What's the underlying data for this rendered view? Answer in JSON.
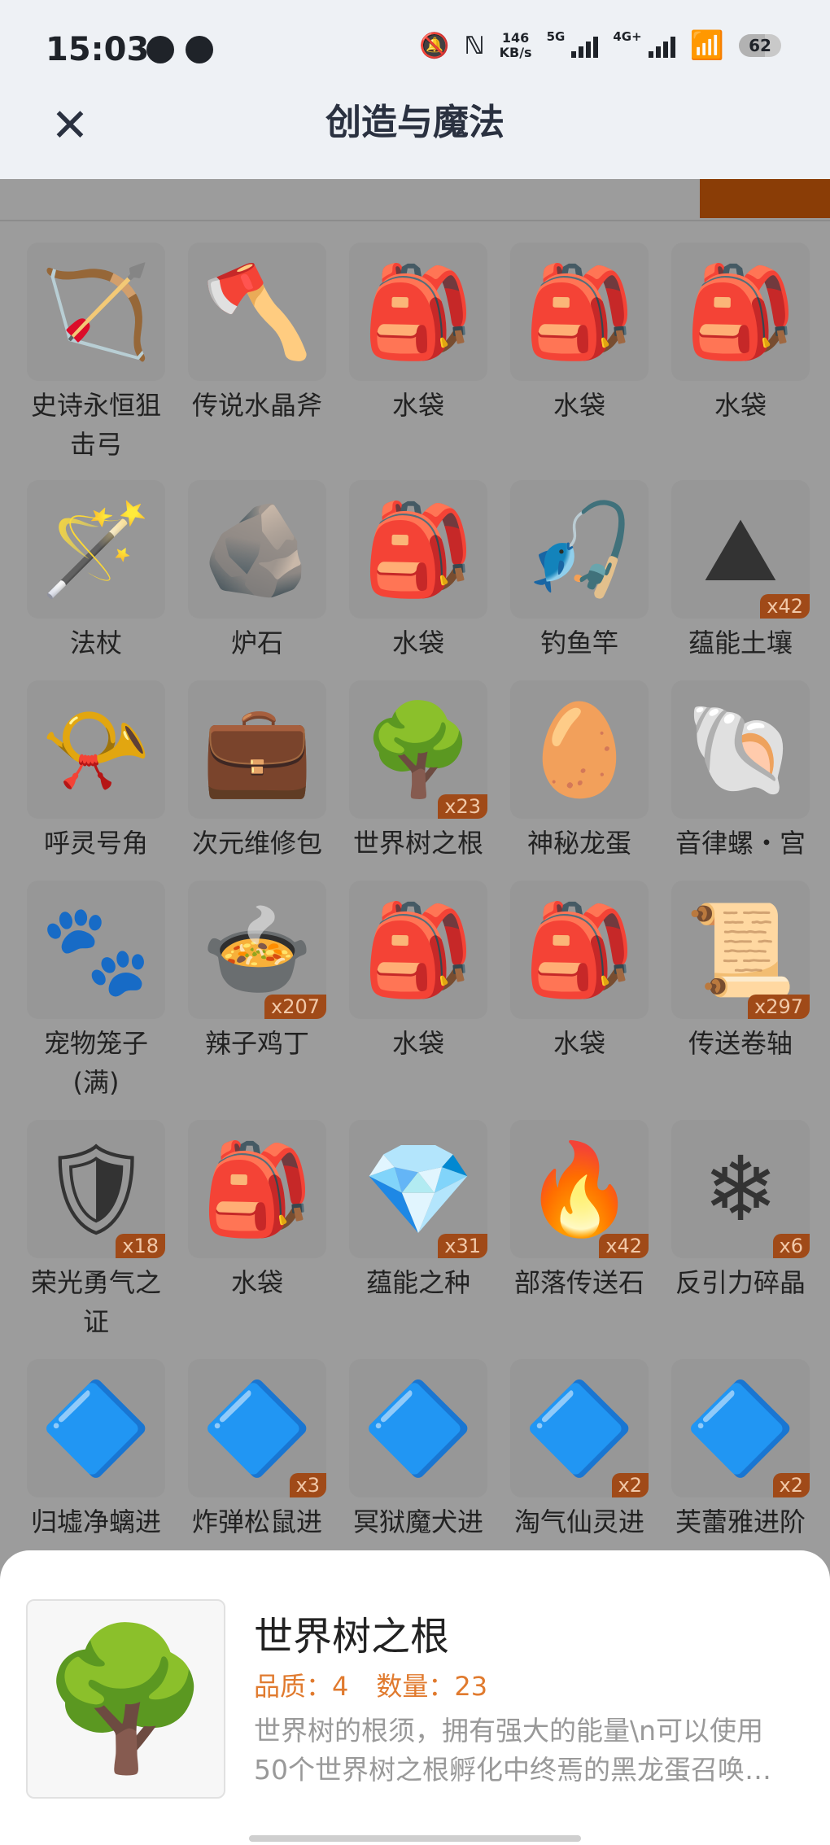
{
  "status_bar": {
    "time": "15:03",
    "left_icons": [
      "qq-icon",
      "wechat-icon"
    ],
    "speed": "146",
    "speed_unit": "KB/s",
    "network_1": "5G",
    "network_2": "4G+",
    "battery": "62"
  },
  "header": {
    "close_label": "✕",
    "title": "创造与魔法"
  },
  "colors": {
    "overlay_grey": "#9c9c9c",
    "badge": "#a04a18",
    "quality_orange": "#e07a2e",
    "active_tab": "#8a3d06"
  },
  "items": [
    [
      {
        "name": "史诗永恒狙击弓",
        "icon": "bow-icon",
        "glyph": "🏹"
      },
      {
        "name": "传说水晶斧",
        "icon": "axe-icon",
        "glyph": "🪓"
      },
      {
        "name": "水袋",
        "icon": "waterbag-icon",
        "glyph": "🎒"
      },
      {
        "name": "水袋",
        "icon": "waterbag-icon",
        "glyph": "🎒"
      },
      {
        "name": "水袋",
        "icon": "waterbag-icon",
        "glyph": "🎒"
      }
    ],
    [
      {
        "name": "法杖",
        "icon": "staff-icon",
        "glyph": "🪄"
      },
      {
        "name": "炉石",
        "icon": "hearthstone-icon",
        "glyph": "🪨"
      },
      {
        "name": "水袋",
        "icon": "waterbag-icon",
        "glyph": "🎒"
      },
      {
        "name": "钓鱼竿",
        "icon": "fishing-rod-icon",
        "glyph": "🎣"
      },
      {
        "name": "蕴能土壤",
        "icon": "soil-icon",
        "glyph": "⛰",
        "count": "x42"
      }
    ],
    [
      {
        "name": "呼灵号角",
        "icon": "horn-icon",
        "glyph": "📯"
      },
      {
        "name": "次元维修包",
        "icon": "repair-bag-icon",
        "glyph": "💼"
      },
      {
        "name": "世界树之根",
        "icon": "tree-root-icon",
        "glyph": "🌳",
        "count": "x23"
      },
      {
        "name": "神秘龙蛋",
        "icon": "dragon-egg-icon",
        "glyph": "🥚"
      },
      {
        "name": "音律螺・宫",
        "icon": "conch-icon",
        "glyph": "🐚"
      }
    ],
    [
      {
        "name": "宠物笼子(满)",
        "icon": "pet-cage-icon",
        "glyph": "🐾"
      },
      {
        "name": "辣子鸡丁",
        "icon": "food-icon",
        "glyph": "🍲",
        "count": "x207"
      },
      {
        "name": "水袋",
        "icon": "waterbag-icon",
        "glyph": "🎒"
      },
      {
        "name": "水袋",
        "icon": "waterbag-icon",
        "glyph": "🎒"
      },
      {
        "name": "传送卷轴",
        "icon": "scroll-icon",
        "glyph": "📜",
        "count": "x297"
      }
    ],
    [
      {
        "name": "荣光勇气之证",
        "icon": "badge-mask-icon",
        "glyph": "🛡",
        "count": "x18"
      },
      {
        "name": "水袋",
        "icon": "waterbag-icon",
        "glyph": "🎒"
      },
      {
        "name": "蕴能之种",
        "icon": "crystal-seed-icon",
        "glyph": "💎",
        "count": "x31"
      },
      {
        "name": "部落传送石",
        "icon": "teleport-stone-icon",
        "glyph": "🔥",
        "count": "x42"
      },
      {
        "name": "反引力碎晶",
        "icon": "antigravity-shard-icon",
        "glyph": "❄",
        "count": "x6"
      }
    ],
    [
      {
        "name": "归墟净螭进",
        "icon": "gem-token-icon",
        "glyph": "🔷"
      },
      {
        "name": "炸弹松鼠进",
        "icon": "gem-token-icon",
        "glyph": "🔷",
        "count": "x3"
      },
      {
        "name": "冥狱魔犬进",
        "icon": "gem-token-icon",
        "glyph": "🔷"
      },
      {
        "name": "淘气仙灵进",
        "icon": "gem-token-icon",
        "glyph": "🔷",
        "count": "x2"
      },
      {
        "name": "芙蕾雅进阶",
        "icon": "gem-token-icon",
        "glyph": "🔷",
        "count": "x2"
      }
    ]
  ],
  "detail": {
    "name": "世界树之根",
    "quality_label": "品质：4",
    "count_label": "数量：23",
    "desc_line1": "世界树的根须，拥有强大的能量\\n可以使用",
    "desc_line2": "50个世界树之根孵化中终焉的黑龙蛋召唤…",
    "icon": "tree-root-icon",
    "glyph": "🌳"
  }
}
